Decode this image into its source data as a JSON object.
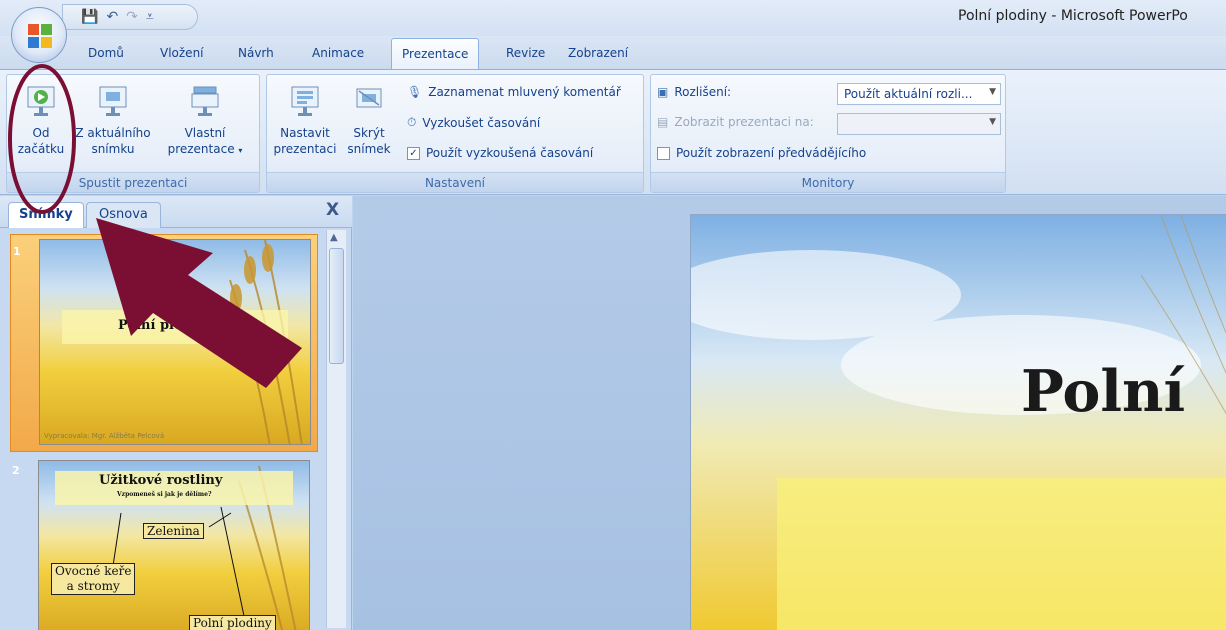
{
  "window": {
    "title": "Polní plodiny - Microsoft PowerPo"
  },
  "qat": {
    "save_icon": "save-icon",
    "undo_icon": "undo-icon",
    "redo_icon": "redo-icon",
    "customize_icon": "customize-icon"
  },
  "tabs": [
    {
      "label": "Domů"
    },
    {
      "label": "Vložení"
    },
    {
      "label": "Návrh"
    },
    {
      "label": "Animace"
    },
    {
      "label": "Prezentace"
    },
    {
      "label": "Revize"
    },
    {
      "label": "Zobrazení"
    }
  ],
  "ribbon": {
    "group_start": {
      "label": "Spustit prezentaci",
      "from_start_1": "Od",
      "from_start_2": "začátku",
      "from_current_1": "Z aktuálního",
      "from_current_2": "snímku",
      "custom_1": "Vlastní",
      "custom_2": "prezentace"
    },
    "group_setup": {
      "label": "Nastavení",
      "setup_1": "Nastavit",
      "setup_2": "prezentaci",
      "hide_1": "Skrýt",
      "hide_2": "snímek",
      "record": "Zaznamenat mluvený komentář",
      "rehearse": "Vyzkoušet časování",
      "use_timings": "Použít vyzkoušená časování",
      "use_timings_checked": true
    },
    "group_monitors": {
      "label": "Monitory",
      "resolution_label": "Rozlišení:",
      "resolution_value": "Použít aktuální rozli...",
      "show_on_label": "Zobrazit prezentaci na:",
      "presenter_view": "Použít zobrazení předvádějícího"
    }
  },
  "pane": {
    "tab_slides": "Snímky",
    "tab_outline": "Osnova",
    "close": "X"
  },
  "slides": [
    {
      "number": "1",
      "title": "Polní plodiny",
      "author": "Vypracovala: Mgr. Alžběta Pelcová"
    },
    {
      "number": "2",
      "title": "Užitkové rostliny",
      "subtitle": "Vzpomeneš si jak je dělíme?",
      "box_vegetables": "Zelenina",
      "box_fruit_1": "Ovocné keře",
      "box_fruit_2": "a stromy",
      "box_crops": "Polní plodiny"
    }
  ],
  "main_slide": {
    "title": "Polní"
  },
  "colors": {
    "annotation": "#7a0f33",
    "selection": "#f2a94a"
  }
}
